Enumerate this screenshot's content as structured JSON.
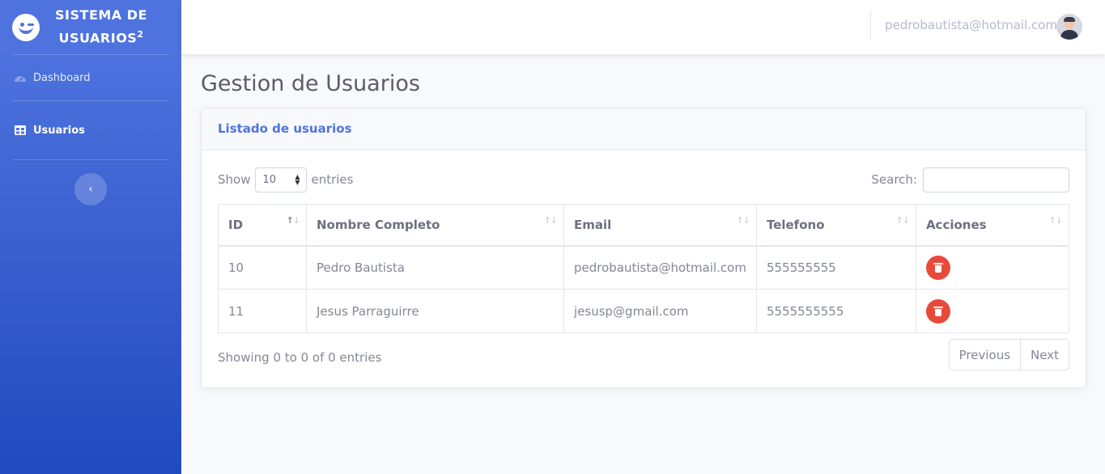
{
  "brand": {
    "title_line1": "SISTEMA DE",
    "title_line2": "USUARIOS",
    "title_sup": "2"
  },
  "sidebar": {
    "items": [
      {
        "label": "Dashboard",
        "icon": "tachometer-icon",
        "active": false
      },
      {
        "label": "Usuarios",
        "icon": "table-icon",
        "active": true
      }
    ],
    "toggle_icon": "chevron-left-icon"
  },
  "topbar": {
    "user_email": "pedrobautista@hotmail.com"
  },
  "page": {
    "title": "Gestion de Usuarios"
  },
  "card": {
    "header": "Listado de usuarios",
    "length": {
      "show_label": "Show",
      "value": "10",
      "entries_label": "entries"
    },
    "search": {
      "label": "Search:",
      "value": ""
    },
    "table": {
      "columns": [
        "ID",
        "Nombre Completo",
        "Email",
        "Telefono",
        "Acciones"
      ],
      "rows": [
        {
          "id": "10",
          "name": "Pedro Bautista",
          "email": "pedrobautista@hotmail.com",
          "phone": "555555555"
        },
        {
          "id": "11",
          "name": "Jesus Parraguirre",
          "email": "jesusp@gmail.com",
          "phone": "5555555555"
        }
      ]
    },
    "info": "Showing 0 to 0 of 0 entries",
    "pagination": {
      "previous": "Previous",
      "next": "Next"
    }
  },
  "colors": {
    "primary": "#4e73df",
    "danger": "#e74a3b",
    "sidebar_end": "#224abe"
  }
}
